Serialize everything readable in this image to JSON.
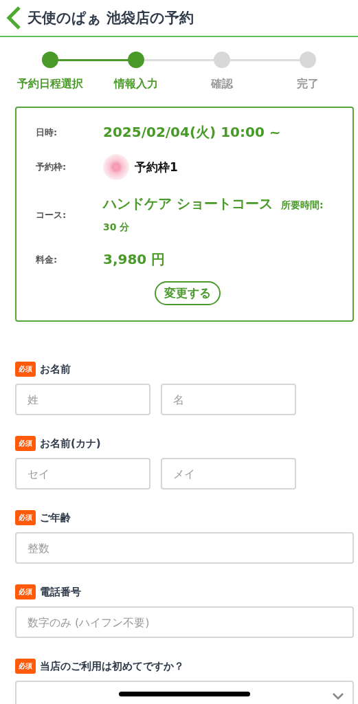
{
  "header": {
    "title": "天使のぱぁ 池袋店の予約"
  },
  "steps": [
    {
      "label": "予約日程選択",
      "completed": true
    },
    {
      "label": "情報入力",
      "completed": true
    },
    {
      "label": "確認",
      "completed": false
    },
    {
      "label": "完了",
      "completed": false
    }
  ],
  "summary": {
    "rows": [
      {
        "kind": "datetime",
        "label": "日時:",
        "value": "2025/02/04(火) 10:00 ~"
      },
      {
        "kind": "slot",
        "label": "予約枠:",
        "value": "予約枠1"
      },
      {
        "kind": "course",
        "label": "コース:",
        "value": "ハンドケア ショートコース",
        "note": "所要時間: 30 分"
      },
      {
        "kind": "fee",
        "label": "料金:",
        "value": "3,980 円"
      }
    ],
    "change_button": "変更する"
  },
  "form": [
    {
      "kind": "pair",
      "badge": "必須",
      "label": "お名前",
      "placeholders": [
        "姓",
        "名"
      ]
    },
    {
      "kind": "pair",
      "badge": "必須",
      "label": "お名前(カナ)",
      "placeholders": [
        "セイ",
        "メイ"
      ]
    },
    {
      "kind": "single",
      "badge": "必須",
      "label": "ご年齢",
      "placeholders": [
        "整数"
      ]
    },
    {
      "kind": "single",
      "badge": "必須",
      "label": "電話番号",
      "placeholders": [
        "数字のみ (ハイフン不要)"
      ]
    },
    {
      "kind": "select",
      "badge": "必須",
      "label": "当店のご利用は初めてですか？"
    }
  ]
}
